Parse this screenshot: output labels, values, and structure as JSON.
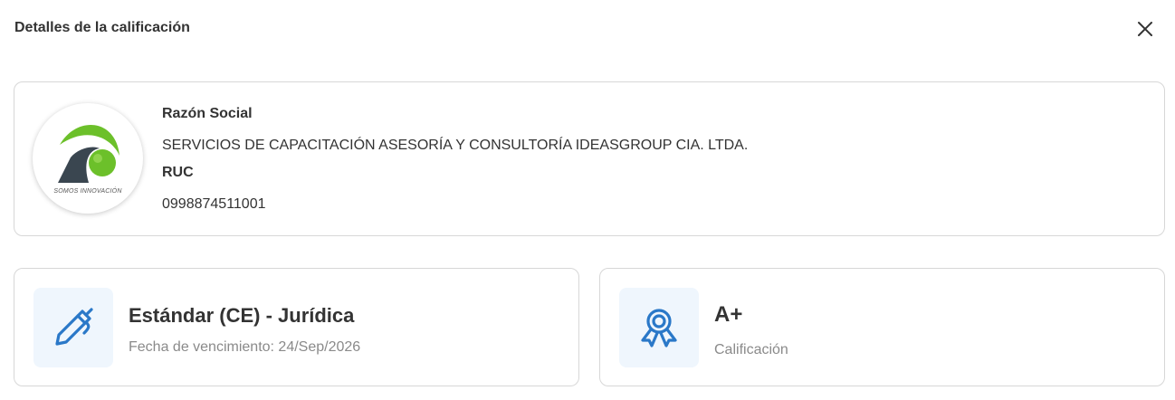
{
  "modal": {
    "title": "Detalles de la calificación",
    "close_icon": "close-icon"
  },
  "company": {
    "logo_icon": "company-logo",
    "logo_tagline": "SOMOS INNOVACIÓN",
    "razon_social_label": "Razón Social",
    "razon_social_value": "SERVICIOS DE CAPACITACIÓN ASESORÍA Y CONSULTORÍA IDEASGROUP CIA. LTDA.",
    "ruc_label": "RUC",
    "ruc_value": "0998874511001"
  },
  "certificate": {
    "icon": "pen-icon",
    "title": "Estándar (CE) - Jurídica",
    "subtitle": "Fecha de vencimiento: 24/Sep/2026"
  },
  "rating": {
    "icon": "award-ribbon-icon",
    "value": "A+",
    "label": "Calificación"
  },
  "colors": {
    "accent_blue": "#2a78c8",
    "icon_tile_bg": "#eff6fd",
    "logo_green": "#6cc02a",
    "logo_dark": "#3a4650",
    "border": "#d7d7d7"
  }
}
